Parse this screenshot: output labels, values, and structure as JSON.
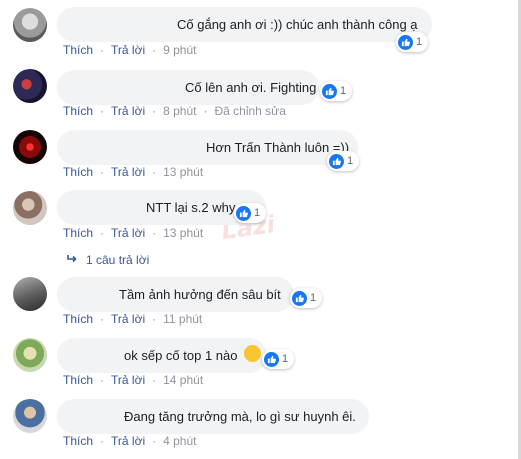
{
  "colors": {
    "bubble_bg": "#f2f3f5",
    "link": "#385898",
    "meta": "#90949c",
    "like_blue": "#1877f2"
  },
  "icons": {
    "like": "thumbs-up-icon",
    "reply_arrow": "reply-arrow-icon",
    "emoji": "wink-emoji-icon"
  },
  "comments": [
    {
      "text": "Cố gắng anh ơi :)) chúc anh thành công ạ",
      "likes": "1",
      "like_label": "Thích",
      "reply_label": "Trả lời",
      "time": "9 phút"
    },
    {
      "text": "Cố lên anh ơi. Fighting",
      "likes": "1",
      "like_label": "Thích",
      "reply_label": "Trả lời",
      "time": "8 phút",
      "edited": "Đã chỉnh sửa"
    },
    {
      "text": "Hơn Trấn Thành luôn =))",
      "likes": "1",
      "like_label": "Thích",
      "reply_label": "Trả lời",
      "time": "13 phút"
    },
    {
      "text": "NTT lại s.2 why",
      "likes": "1",
      "like_label": "Thích",
      "reply_label": "Trả lời",
      "time": "13 phút",
      "replies": "1 câu trả lời"
    },
    {
      "text": "Tầm ảnh hưởng đến sâu bít",
      "likes": "1",
      "like_label": "Thích",
      "reply_label": "Trả lời",
      "time": "11 phút"
    },
    {
      "text": "ok sếp cố top 1 nào",
      "likes": "1",
      "like_label": "Thích",
      "reply_label": "Trả lời",
      "time": "14 phút"
    },
    {
      "text": "Đang tăng trưởng mà, lo gì sư huynh êi.",
      "like_label": "Thích",
      "reply_label": "Trả lời",
      "time": "4 phút"
    }
  ]
}
